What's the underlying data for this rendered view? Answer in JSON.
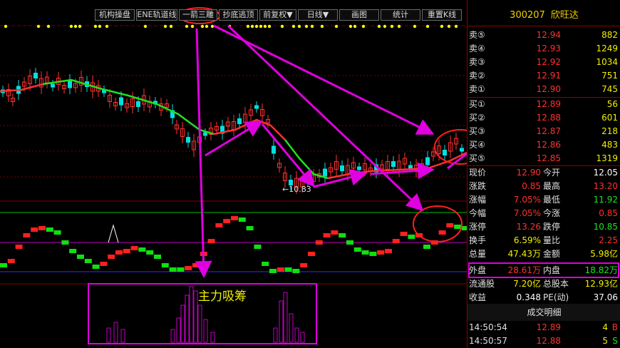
{
  "toolbar": {
    "buttons": [
      "机构操盘",
      "ENE轨道线",
      "一箭三雕",
      "抄底逃顶",
      "前复权▼",
      "日线▼",
      "画图",
      "统计",
      "重置K线"
    ]
  },
  "chart": {
    "low_marker": "←10.83",
    "annotation": "主力吸筹"
  },
  "stock": {
    "code": "300207",
    "name": "欣旺达"
  },
  "orderbook": {
    "asks": [
      {
        "label": "卖⑤",
        "price": "12.94",
        "vol": "882"
      },
      {
        "label": "卖④",
        "price": "12.93",
        "vol": "1249"
      },
      {
        "label": "卖③",
        "price": "12.92",
        "vol": "1034"
      },
      {
        "label": "卖②",
        "price": "12.91",
        "vol": "751"
      },
      {
        "label": "卖①",
        "price": "12.90",
        "vol": "745"
      }
    ],
    "bids": [
      {
        "label": "买①",
        "price": "12.89",
        "vol": "56"
      },
      {
        "label": "买②",
        "price": "12.88",
        "vol": "601"
      },
      {
        "label": "买③",
        "price": "12.87",
        "vol": "218"
      },
      {
        "label": "买④",
        "price": "12.86",
        "vol": "483"
      },
      {
        "label": "买⑤",
        "price": "12.85",
        "vol": "1319"
      }
    ]
  },
  "stats": [
    {
      "l1": "现价",
      "v1": "12.90",
      "l2": "今开",
      "v2": "12.05",
      "c1": "#ff3030",
      "c2": "#ffffff"
    },
    {
      "l1": "涨跌",
      "v1": "0.85",
      "l2": "最高",
      "v2": "13.20",
      "c1": "#ff3030",
      "c2": "#ff3030"
    },
    {
      "l1": "涨幅",
      "v1": "7.05%",
      "l2": "最低",
      "v2": "11.92",
      "c1": "#ff3030",
      "c2": "#20e020"
    },
    {
      "l1": "今幅",
      "v1": "7.05%",
      "l2": "今涨",
      "v2": "0.85",
      "c1": "#ff3030",
      "c2": "#ff3030"
    },
    {
      "l1": "涨停",
      "v1": "13.26",
      "l2": "跌停",
      "v2": "10.85",
      "c1": "#ff3030",
      "c2": "#20e020"
    },
    {
      "l1": "换手",
      "v1": "6.59%",
      "l2": "量比",
      "v2": "2.25",
      "c1": "#f0f000",
      "c2": "#ff3030"
    },
    {
      "l1": "总量",
      "v1": "47.43万",
      "l2": "金额",
      "v2": "5.98亿",
      "c1": "#f0f000",
      "c2": "#f0f000"
    },
    {
      "l1": "外盘",
      "v1": "28.61万",
      "l2": "内盘",
      "v2": "18.82万",
      "c1": "#ff3030",
      "c2": "#20e020"
    },
    {
      "l1": "流通股",
      "v1": "7.20亿",
      "l2": "总股本",
      "v2": "12.93亿",
      "c1": "#f0f000",
      "c2": "#f0f000"
    },
    {
      "l1": "收益",
      "v1": "0.348",
      "l2": "PE(动)",
      "v2": "37.06",
      "c1": "#ffffff",
      "c2": "#ffffff"
    }
  ],
  "ticks_title": "成交明细",
  "ticks": [
    {
      "time": "14:50:54",
      "price": "12.89",
      "vol": "4",
      "side": "B"
    },
    {
      "time": "14:50:57",
      "price": "12.88",
      "vol": "5",
      "side": "S"
    }
  ],
  "colors": {
    "up": "#ff3030",
    "down": "#20e020",
    "label": "#e0e0e0",
    "volume": "#f0f000",
    "annotation": "#e000e0",
    "grid": "#8a0000",
    "title": "#f0d000"
  }
}
